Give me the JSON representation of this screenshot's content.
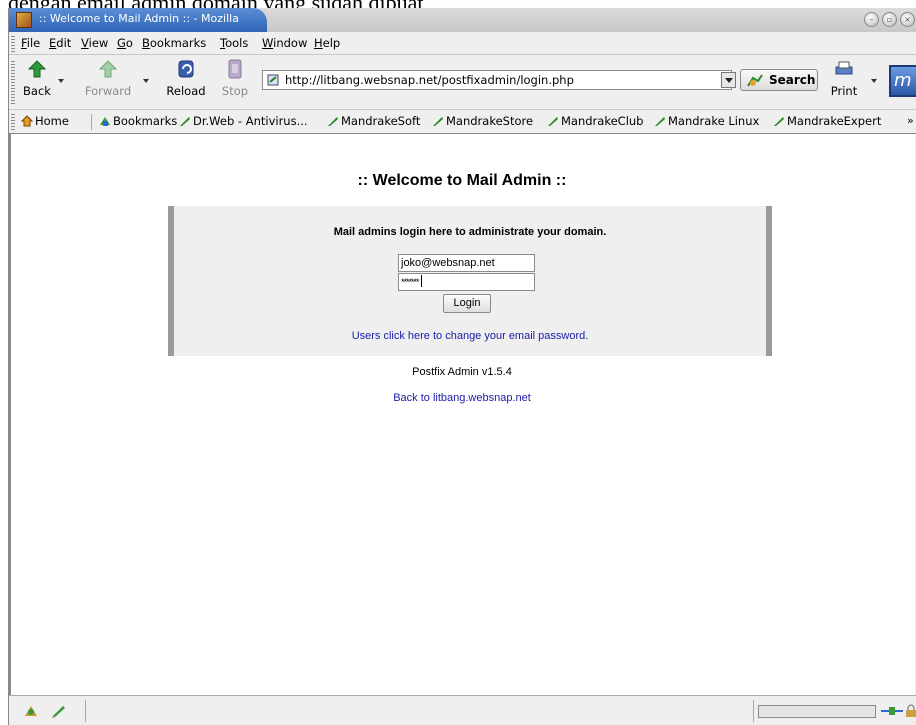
{
  "document": {
    "caption": "dengan email admin domain yang sudah dibuat"
  },
  "window": {
    "title": ":: Welcome to Mail Admin :: - Mozilla"
  },
  "menu": [
    "File",
    "Edit",
    "View",
    "Go",
    "Bookmarks",
    "Tools",
    "Window",
    "Help"
  ],
  "toolbar": {
    "back": "Back",
    "forward": "Forward",
    "reload": "Reload",
    "stop": "Stop",
    "url": "http://litbang.websnap.net/postfixadmin/login.php",
    "search": "Search",
    "print": "Print"
  },
  "bookmarks": [
    "Home",
    "Bookmarks",
    "Dr.Web - Antivirus...",
    "MandrakeSoft",
    "MandrakeStore",
    "MandrakeClub",
    "Mandrake Linux",
    "MandrakeExpert"
  ],
  "page": {
    "title": ":: Welcome to Mail Admin ::",
    "login_heading": "Mail admins login here to administrate your domain.",
    "username_value": "joko@websnap.net",
    "password_mask": "*******",
    "login_button": "Login",
    "change_password_link": "Users click here to change your email password.",
    "version": "Postfix Admin v1.5.4",
    "back_link": "Back to litbang.websnap.net"
  },
  "status": {
    "progress": 0
  },
  "colors": {
    "link": "#1c1ca8",
    "title_tab": "#2f63b5",
    "panel_border": "#9a9a9a"
  },
  "icons": {
    "back": "green-left-arrow-icon",
    "forward": "green-right-arrow-icon",
    "reload": "reload-icon",
    "stop": "stop-icon",
    "search": "search-icon",
    "print": "printer-icon",
    "bookmark": "mandrake-star-icon"
  }
}
